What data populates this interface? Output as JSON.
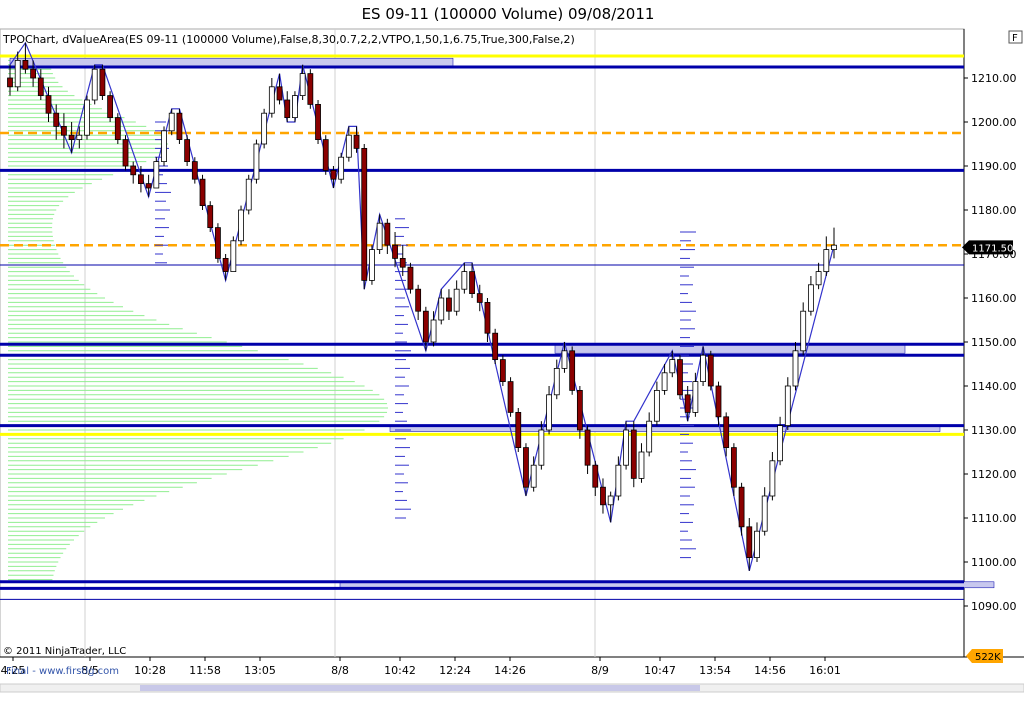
{
  "title": "ES 09-11 (100000 Volume)  09/08/2011",
  "indicator": "TPOChart, dValueArea(ES 09-11 (100000 Volume),False,8,30,0.7,2,2,VTPO,1,50,1,6.75,True,300,False,2)",
  "copyright": "© 2011 NinjaTrader, LLC",
  "watermark": "Final - www.firstlg.com",
  "panel_button": "F",
  "colors": {
    "up_candle": "#FFFFFF",
    "down_candle": "#8B0000",
    "value_area_band": "#0000AA",
    "poc_line": "#FFA500",
    "session_line": "#FFFF00",
    "profile_bars": "#90EE90",
    "zigzag": "#3333CC",
    "last_price_marker": "#000000",
    "volume_marker": "#FFA500"
  },
  "chart_data": {
    "type": "candlestick",
    "y_axis": {
      "ticks": [
        "1210.00",
        "1200.00",
        "1190.00",
        "1180.00",
        "1170.00",
        "1160.00",
        "1150.00",
        "1140.00",
        "1130.00",
        "1120.00",
        "1110.00",
        "1100.00",
        "1090.00"
      ],
      "ylim": [
        1088,
        1218
      ]
    },
    "x_tick_labels": [
      "4:25",
      "8/5",
      "10:28",
      "11:58",
      "13:05",
      "8/8",
      "10:42",
      "12:24",
      "14:26",
      "8/9",
      "10:47",
      "13:54",
      "14:56",
      "16:01"
    ],
    "last_price": "1171.50",
    "volume_marker": "522K",
    "horizontal_levels": {
      "session_high_low": [
        1215,
        1129
      ],
      "poc": [
        1197.5,
        1172
      ],
      "value_area_bounds": [
        1212.5,
        1189,
        1149.5,
        1147,
        1131,
        1095.5,
        1094
      ],
      "thin": [
        1167.5,
        1091.5
      ]
    },
    "ohlc": [
      [
        1210,
        1213,
        1206,
        1208
      ],
      [
        1208,
        1216,
        1207,
        1214
      ],
      [
        1214,
        1218,
        1211,
        1212
      ],
      [
        1212,
        1214,
        1208,
        1210
      ],
      [
        1210,
        1212,
        1205,
        1206
      ],
      [
        1206,
        1208,
        1200,
        1202
      ],
      [
        1202,
        1204,
        1196,
        1199
      ],
      [
        1199,
        1202,
        1194,
        1197
      ],
      [
        1197,
        1200,
        1193,
        1196
      ],
      [
        1196,
        1199,
        1194,
        1197
      ],
      [
        1197,
        1206,
        1196,
        1205
      ],
      [
        1205,
        1213,
        1204,
        1212
      ],
      [
        1212,
        1213,
        1205,
        1206
      ],
      [
        1206,
        1207,
        1200,
        1201
      ],
      [
        1201,
        1202,
        1195,
        1196
      ],
      [
        1196,
        1197,
        1189,
        1190
      ],
      [
        1190,
        1191,
        1186,
        1188
      ],
      [
        1188,
        1190,
        1184,
        1186
      ],
      [
        1186,
        1188,
        1183,
        1185
      ],
      [
        1185,
        1192,
        1185,
        1191
      ],
      [
        1191,
        1199,
        1190,
        1198
      ],
      [
        1198,
        1203,
        1197,
        1202
      ],
      [
        1202,
        1203,
        1195,
        1196
      ],
      [
        1196,
        1197,
        1190,
        1191
      ],
      [
        1191,
        1192,
        1186,
        1187
      ],
      [
        1187,
        1188,
        1180,
        1181
      ],
      [
        1181,
        1182,
        1175,
        1176
      ],
      [
        1176,
        1177,
        1168,
        1169
      ],
      [
        1169,
        1170,
        1164,
        1166
      ],
      [
        1166,
        1174,
        1166,
        1173
      ],
      [
        1173,
        1181,
        1172,
        1180
      ],
      [
        1180,
        1188,
        1179,
        1187
      ],
      [
        1187,
        1196,
        1186,
        1195
      ],
      [
        1195,
        1203,
        1194,
        1202
      ],
      [
        1202,
        1210,
        1201,
        1208
      ],
      [
        1208,
        1211,
        1204,
        1205
      ],
      [
        1205,
        1207,
        1200,
        1201
      ],
      [
        1201,
        1207,
        1200,
        1206
      ],
      [
        1206,
        1213,
        1205,
        1211
      ],
      [
        1211,
        1212,
        1203,
        1204
      ],
      [
        1204,
        1205,
        1195,
        1196
      ],
      [
        1196,
        1197,
        1188,
        1189
      ],
      [
        1189,
        1190,
        1185,
        1187
      ],
      [
        1187,
        1193,
        1186,
        1192
      ],
      [
        1192,
        1199,
        1191,
        1197
      ],
      [
        1197,
        1199,
        1193,
        1194
      ],
      [
        1194,
        1195,
        1162,
        1164
      ],
      [
        1164,
        1172,
        1163,
        1171
      ],
      [
        1171,
        1179,
        1170,
        1177
      ],
      [
        1177,
        1178,
        1170,
        1172
      ],
      [
        1172,
        1175,
        1167,
        1169
      ],
      [
        1169,
        1172,
        1165,
        1167
      ],
      [
        1167,
        1168,
        1161,
        1162
      ],
      [
        1162,
        1163,
        1155,
        1157
      ],
      [
        1157,
        1158,
        1148,
        1150
      ],
      [
        1150,
        1157,
        1149,
        1155
      ],
      [
        1155,
        1162,
        1154,
        1160
      ],
      [
        1160,
        1162,
        1155,
        1157
      ],
      [
        1157,
        1164,
        1156,
        1162
      ],
      [
        1162,
        1168,
        1161,
        1166
      ],
      [
        1166,
        1168,
        1160,
        1161
      ],
      [
        1161,
        1163,
        1157,
        1159
      ],
      [
        1159,
        1160,
        1150,
        1152
      ],
      [
        1152,
        1153,
        1145,
        1146
      ],
      [
        1146,
        1147,
        1140,
        1141
      ],
      [
        1141,
        1142,
        1133,
        1134
      ],
      [
        1134,
        1135,
        1125,
        1126
      ],
      [
        1126,
        1127,
        1115,
        1117
      ],
      [
        1117,
        1124,
        1116,
        1122
      ],
      [
        1122,
        1132,
        1121,
        1130
      ],
      [
        1130,
        1140,
        1129,
        1138
      ],
      [
        1138,
        1146,
        1137,
        1144
      ],
      [
        1144,
        1150,
        1143,
        1148
      ],
      [
        1148,
        1149,
        1138,
        1139
      ],
      [
        1139,
        1140,
        1128,
        1130
      ],
      [
        1130,
        1131,
        1120,
        1122
      ],
      [
        1122,
        1123,
        1115,
        1117
      ],
      [
        1117,
        1119,
        1111,
        1113
      ],
      [
        1113,
        1116,
        1109,
        1115
      ],
      [
        1115,
        1124,
        1114,
        1122
      ],
      [
        1122,
        1132,
        1121,
        1130
      ],
      [
        1130,
        1132,
        1117,
        1119
      ],
      [
        1119,
        1127,
        1118,
        1125
      ],
      [
        1125,
        1134,
        1124,
        1132
      ],
      [
        1132,
        1141,
        1131,
        1139
      ],
      [
        1139,
        1145,
        1138,
        1143
      ],
      [
        1143,
        1148,
        1142,
        1146
      ],
      [
        1146,
        1147,
        1137,
        1138
      ],
      [
        1138,
        1140,
        1132,
        1134
      ],
      [
        1134,
        1143,
        1133,
        1141
      ],
      [
        1141,
        1149,
        1140,
        1147
      ],
      [
        1147,
        1148,
        1139,
        1140
      ],
      [
        1140,
        1141,
        1131,
        1133
      ],
      [
        1133,
        1134,
        1124,
        1126
      ],
      [
        1126,
        1127,
        1115,
        1117
      ],
      [
        1117,
        1118,
        1106,
        1108
      ],
      [
        1108,
        1110,
        1098,
        1101
      ],
      [
        1101,
        1109,
        1100,
        1107
      ],
      [
        1107,
        1117,
        1106,
        1115
      ],
      [
        1115,
        1125,
        1114,
        1123
      ],
      [
        1123,
        1133,
        1122,
        1131
      ],
      [
        1131,
        1142,
        1130,
        1140
      ],
      [
        1140,
        1150,
        1139,
        1148
      ],
      [
        1148,
        1159,
        1147,
        1157
      ],
      [
        1157,
        1165,
        1156,
        1163
      ],
      [
        1163,
        1168,
        1162,
        1166
      ],
      [
        1166,
        1174,
        1165,
        1171
      ],
      [
        1171,
        1176,
        1169,
        1172
      ]
    ]
  }
}
